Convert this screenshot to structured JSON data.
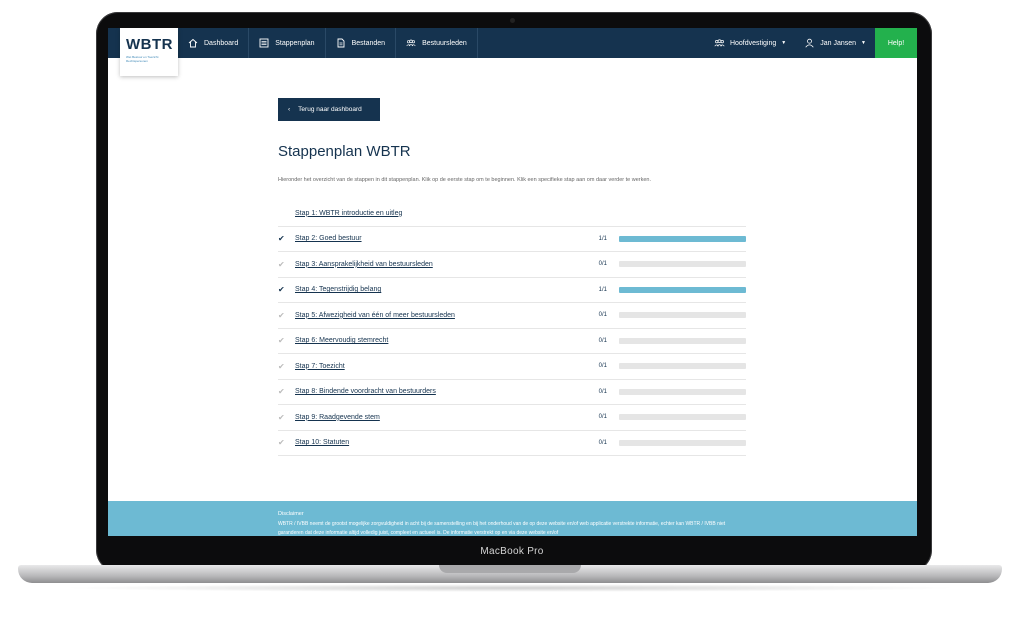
{
  "device": {
    "label": "MacBook Pro"
  },
  "logo": {
    "text": "WBTR",
    "sub": "Wet Bestuur en Toezicht Rechtspersonen"
  },
  "nav": {
    "items": [
      {
        "label": "Dashboard",
        "icon": "home-icon"
      },
      {
        "label": "Stappenplan",
        "icon": "checklist-icon"
      },
      {
        "label": "Bestanden",
        "icon": "file-icon"
      },
      {
        "label": "Bestuursleden",
        "icon": "group-icon"
      }
    ],
    "location": "Hoofdvestiging",
    "user": "Jan Jansen",
    "help": "Help!"
  },
  "back_label": "Terug naar dashboard",
  "title": "Stappenplan WBTR",
  "intro": "Hieronder het overzicht van de stappen in dit stappenplan. Klik op de eerste stap om te beginnen. Klik een specifieke stap aan om daar verder te werken.",
  "steps": [
    {
      "label": "Stap 1: WBTR introductie en uitleg",
      "count": "",
      "progress": null,
      "done": false
    },
    {
      "label": "Stap 2: Goed bestuur",
      "count": "1/1",
      "progress": 1,
      "done": true
    },
    {
      "label": "Stap 3: Aansprakelijkheid van bestuursleden",
      "count": "0/1",
      "progress": 0,
      "done": false
    },
    {
      "label": "Stap 4: Tegenstrijdig belang",
      "count": "1/1",
      "progress": 1,
      "done": true
    },
    {
      "label": "Stap 5: Afwezigheid van één of meer bestuursleden",
      "count": "0/1",
      "progress": 0,
      "done": false
    },
    {
      "label": "Stap 6: Meervoudig stemrecht",
      "count": "0/1",
      "progress": 0,
      "done": false
    },
    {
      "label": "Stap 7: Toezicht",
      "count": "0/1",
      "progress": 0,
      "done": false
    },
    {
      "label": "Stap 8: Bindende voordracht van bestuurders",
      "count": "0/1",
      "progress": 0,
      "done": false
    },
    {
      "label": "Stap 9: Raadgevende stem",
      "count": "0/1",
      "progress": 0,
      "done": false
    },
    {
      "label": "Stap 10: Statuten",
      "count": "0/1",
      "progress": 0,
      "done": false
    }
  ],
  "footer": {
    "title": "Disclaimer",
    "text": "WBTR / IVBB neemt de grootst mogelijke zorgvuldigheid in acht bij de samenstelling en bij het onderhoud van de op deze website en/of web applicatie verstrekte informatie, echter kan WBTR / IVBB niet garanderen dat deze informatie altijd volledig juist, compleet en actueel is. De informatie verstrekt op en via deze website en/of"
  }
}
